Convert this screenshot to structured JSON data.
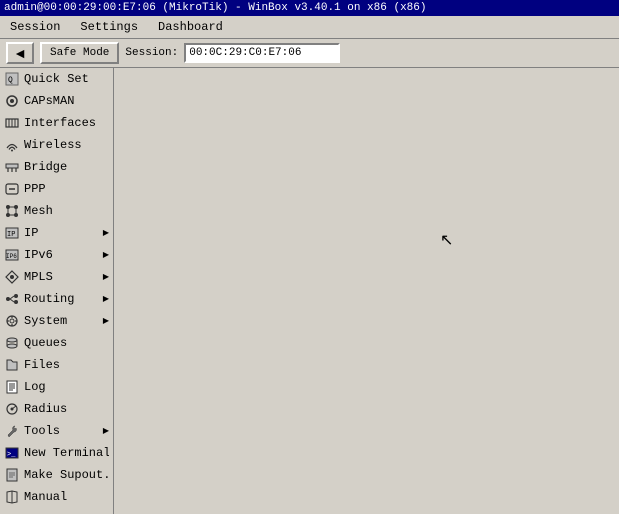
{
  "titlebar": {
    "text": "admin@00:00:29:00:E7:06 (MikroTik) - WinBox v3.40.1 on x86 (x86)"
  },
  "menubar": {
    "items": [
      "Session",
      "Settings",
      "Dashboard"
    ]
  },
  "toolbar": {
    "back_label": "◄",
    "safe_mode_label": "Safe Mode",
    "session_label": "Session:",
    "session_value": "00:0C:29:C0:E7:06"
  },
  "sidebar": {
    "items": [
      {
        "id": "quick-set",
        "label": "Quick Set",
        "icon": "quickset",
        "has_arrow": false
      },
      {
        "id": "capsman",
        "label": "CAPsMAN",
        "icon": "capsman",
        "has_arrow": false
      },
      {
        "id": "interfaces",
        "label": "Interfaces",
        "icon": "interfaces",
        "has_arrow": false
      },
      {
        "id": "wireless",
        "label": "Wireless",
        "icon": "wireless",
        "has_arrow": false
      },
      {
        "id": "bridge",
        "label": "Bridge",
        "icon": "bridge",
        "has_arrow": false
      },
      {
        "id": "ppp",
        "label": "PPP",
        "icon": "ppp",
        "has_arrow": false
      },
      {
        "id": "mesh",
        "label": "Mesh",
        "icon": "mesh",
        "has_arrow": false
      },
      {
        "id": "ip",
        "label": "IP",
        "icon": "ip",
        "has_arrow": true
      },
      {
        "id": "ipv6",
        "label": "IPv6",
        "icon": "ipv6",
        "has_arrow": true
      },
      {
        "id": "mpls",
        "label": "MPLS",
        "icon": "mpls",
        "has_arrow": true
      },
      {
        "id": "routing",
        "label": "Routing",
        "icon": "routing",
        "has_arrow": true
      },
      {
        "id": "system",
        "label": "System",
        "icon": "system",
        "has_arrow": true
      },
      {
        "id": "queues",
        "label": "Queues",
        "icon": "queues",
        "has_arrow": false
      },
      {
        "id": "files",
        "label": "Files",
        "icon": "files",
        "has_arrow": false
      },
      {
        "id": "log",
        "label": "Log",
        "icon": "log",
        "has_arrow": false
      },
      {
        "id": "radius",
        "label": "Radius",
        "icon": "radius",
        "has_arrow": false
      },
      {
        "id": "tools",
        "label": "Tools",
        "icon": "tools",
        "has_arrow": true
      },
      {
        "id": "new-terminal",
        "label": "New Terminal",
        "icon": "terminal",
        "has_arrow": false
      },
      {
        "id": "make-supout",
        "label": "Make Supout.rif",
        "icon": "supout",
        "has_arrow": false
      },
      {
        "id": "manual",
        "label": "Manual",
        "icon": "manual",
        "has_arrow": false
      }
    ]
  }
}
